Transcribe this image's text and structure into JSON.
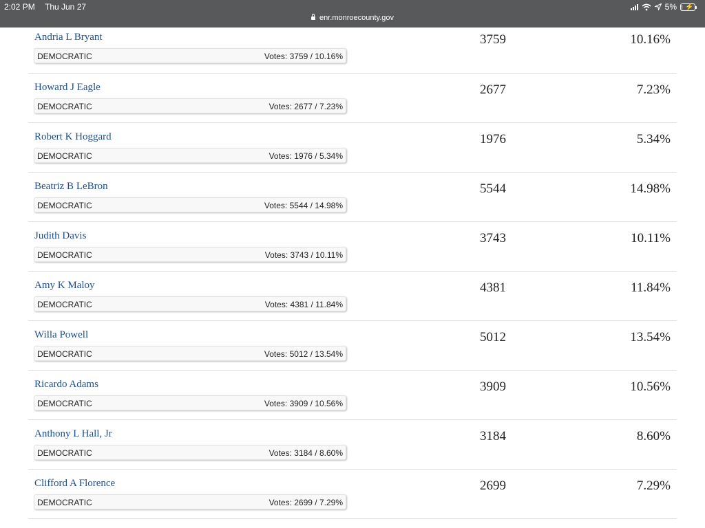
{
  "status_bar": {
    "time": "2:02 PM",
    "date": "Thu Jun 27",
    "battery": "5%",
    "battery_level": 0.05,
    "icons": [
      "signal-icon",
      "wifi-icon",
      "location-icon",
      "battery-icon"
    ]
  },
  "address_bar": {
    "url": "enr.monroecounty.gov",
    "icon": "lock-icon"
  },
  "colors": {
    "header_bg": "#58595b",
    "candidate_link": "#1f4e8c",
    "row_divider": "#dddddd"
  },
  "candidates": [
    {
      "name": "Andria L Bryant",
      "party": "DEMOCRATIC",
      "votes_text": "Votes: 3759 / 10.16%",
      "votes": "3759",
      "percent": "10.16%"
    },
    {
      "name": "Howard J Eagle",
      "party": "DEMOCRATIC",
      "votes_text": "Votes: 2677 / 7.23%",
      "votes": "2677",
      "percent": "7.23%"
    },
    {
      "name": "Robert K Hoggard",
      "party": "DEMOCRATIC",
      "votes_text": "Votes: 1976 / 5.34%",
      "votes": "1976",
      "percent": "5.34%"
    },
    {
      "name": "Beatriz B LeBron",
      "party": "DEMOCRATIC",
      "votes_text": "Votes: 5544 / 14.98%",
      "votes": "5544",
      "percent": "14.98%"
    },
    {
      "name": "Judith Davis",
      "party": "DEMOCRATIC",
      "votes_text": "Votes: 3743 / 10.11%",
      "votes": "3743",
      "percent": "10.11%"
    },
    {
      "name": "Amy K Maloy",
      "party": "DEMOCRATIC",
      "votes_text": "Votes: 4381 / 11.84%",
      "votes": "4381",
      "percent": "11.84%"
    },
    {
      "name": "Willa Powell",
      "party": "DEMOCRATIC",
      "votes_text": "Votes: 5012 / 13.54%",
      "votes": "5012",
      "percent": "13.54%"
    },
    {
      "name": "Ricardo Adams",
      "party": "DEMOCRATIC",
      "votes_text": "Votes: 3909 / 10.56%",
      "votes": "3909",
      "percent": "10.56%"
    },
    {
      "name": "Anthony L Hall, Jr",
      "party": "DEMOCRATIC",
      "votes_text": "Votes: 3184 / 8.60%",
      "votes": "3184",
      "percent": "8.60%"
    },
    {
      "name": "Clifford A Florence",
      "party": "DEMOCRATIC",
      "votes_text": "Votes: 2699 / 7.29%",
      "votes": "2699",
      "percent": "7.29%"
    }
  ]
}
